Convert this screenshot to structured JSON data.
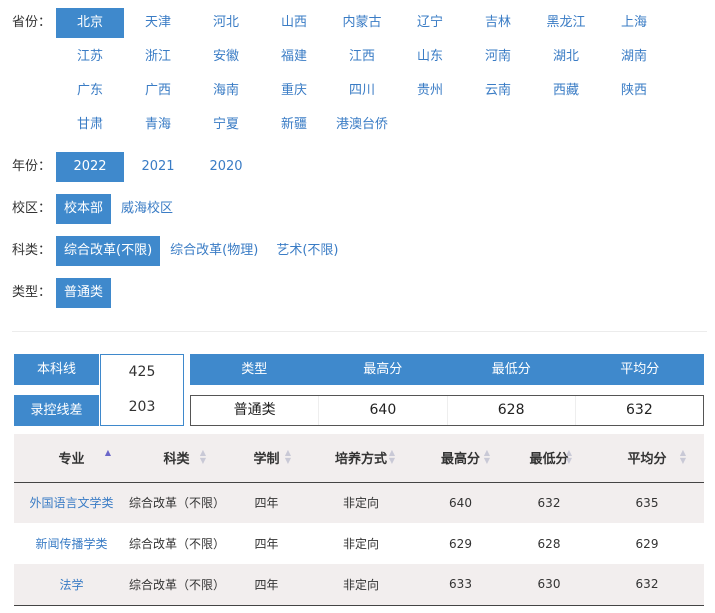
{
  "filters": {
    "province": {
      "label": "省份：",
      "options": [
        "北京",
        "天津",
        "河北",
        "山西",
        "内蒙古",
        "辽宁",
        "吉林",
        "黑龙江",
        "上海",
        "江苏",
        "浙江",
        "安徽",
        "福建",
        "江西",
        "山东",
        "河南",
        "湖北",
        "湖南",
        "广东",
        "广西",
        "海南",
        "重庆",
        "四川",
        "贵州",
        "云南",
        "西藏",
        "陕西",
        "甘肃",
        "青海",
        "宁夏",
        "新疆",
        "港澳台侨"
      ],
      "selected": "北京"
    },
    "year": {
      "label": "年份：",
      "options": [
        "2022",
        "2021",
        "2020"
      ],
      "selected": "2022"
    },
    "campus": {
      "label": "校区：",
      "options": [
        "校本部",
        "威海校区"
      ],
      "selected": "校本部"
    },
    "category": {
      "label": "科类：",
      "options": [
        "综合改革(不限)",
        "综合改革(物理)",
        "艺术(不限)"
      ],
      "selected": "综合改革(不限)"
    },
    "type": {
      "label": "类型：",
      "options": [
        "普通类"
      ],
      "selected": "普通类"
    }
  },
  "summary": {
    "benke_label": "本科线",
    "benke_value": "425",
    "diff_label": "录控线差",
    "diff_value": "203",
    "stat_headers": [
      "类型",
      "最高分",
      "最低分",
      "平均分"
    ],
    "stat_row": [
      "普通类",
      "640",
      "628",
      "632"
    ]
  },
  "table": {
    "headers": [
      "专业",
      "科类",
      "学制",
      "培养方式",
      "最高分",
      "最低分",
      "平均分"
    ],
    "rows": [
      [
        "外国语言文学类",
        "综合改革（不限）",
        "四年",
        "非定向",
        "640",
        "632",
        "635"
      ],
      [
        "新闻传播学类",
        "综合改革（不限）",
        "四年",
        "非定向",
        "629",
        "628",
        "629"
      ],
      [
        "法学",
        "综合改革（不限）",
        "四年",
        "非定向",
        "633",
        "630",
        "632"
      ]
    ]
  },
  "colors": {
    "accent": "#3f89cc",
    "link": "#3a7cc5",
    "stripe": "#f2eeee"
  }
}
